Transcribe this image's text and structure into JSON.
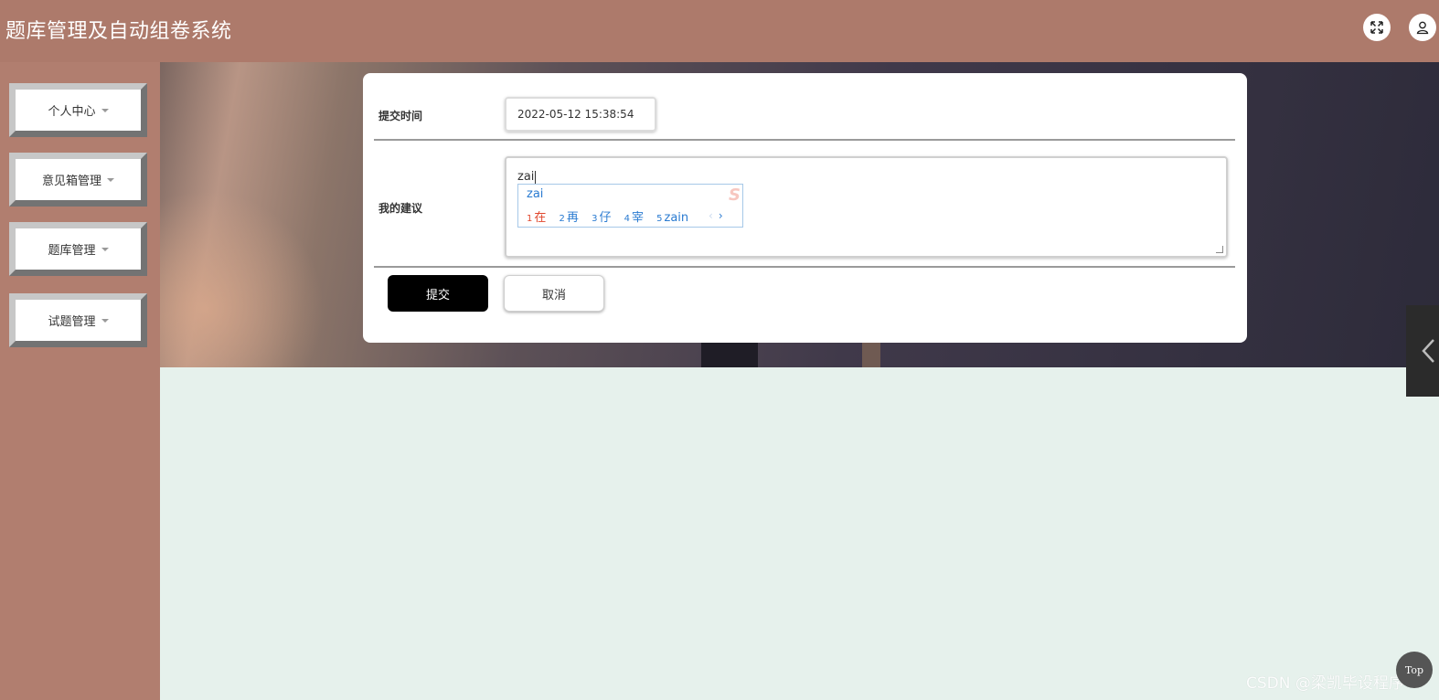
{
  "header": {
    "title": "题库管理及自动组卷系统",
    "fullscreen_icon": "expand-arrows-icon",
    "user_icon": "user-icon"
  },
  "sidebar": {
    "items": [
      {
        "label": "个人中心"
      },
      {
        "label": "意见箱管理"
      },
      {
        "label": "题库管理"
      },
      {
        "label": "试题管理"
      }
    ]
  },
  "form": {
    "submit_time_label": "提交时间",
    "submit_time_value": "2022-05-12 15:38:54",
    "suggestion_label": "我的建议",
    "suggestion_value": "zai",
    "submit_button": "提交",
    "cancel_button": "取消"
  },
  "ime": {
    "composition": "zai",
    "candidates": [
      {
        "num": "1",
        "text": "在"
      },
      {
        "num": "2",
        "text": "再"
      },
      {
        "num": "3",
        "text": "仔"
      },
      {
        "num": "4",
        "text": "宰"
      },
      {
        "num": "5",
        "text": "zain"
      }
    ],
    "prev": "‹",
    "next": "›",
    "logo": "S"
  },
  "float": {
    "top_label": "Top",
    "side_tab_icon": "chevron-left-icon"
  },
  "watermark": "CSDN @梁凯毕设程序",
  "colors": {
    "header_bg": "#ad7a6b",
    "sidebar_bg": "#b17e6f",
    "content_bg": "#e6f1ec",
    "submit_bg": "#000000",
    "ime_accent": "#2a7bd1"
  }
}
